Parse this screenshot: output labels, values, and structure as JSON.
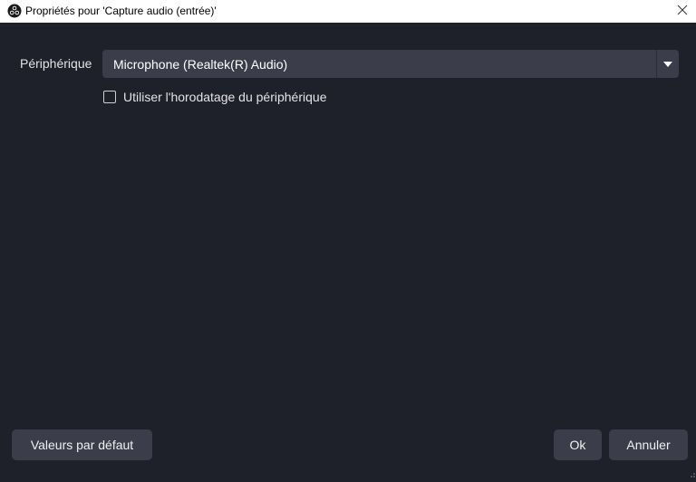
{
  "window": {
    "title": "Propriétés pour 'Capture audio (entrée)'",
    "icon": "obs-logo-icon",
    "close_icon": "close-icon"
  },
  "form": {
    "device_label": "Périphérique",
    "device_value": "Microphone (Realtek(R) Audio)",
    "use_device_timestamp_label": "Utiliser l'horodatage du périphérique",
    "use_device_timestamp_checked": false
  },
  "footer": {
    "defaults_label": "Valeurs par défaut",
    "ok_label": "Ok",
    "cancel_label": "Annuler"
  },
  "colors": {
    "background": "#1f212a",
    "control": "#3b3d4a",
    "text": "#e4e4e6"
  }
}
